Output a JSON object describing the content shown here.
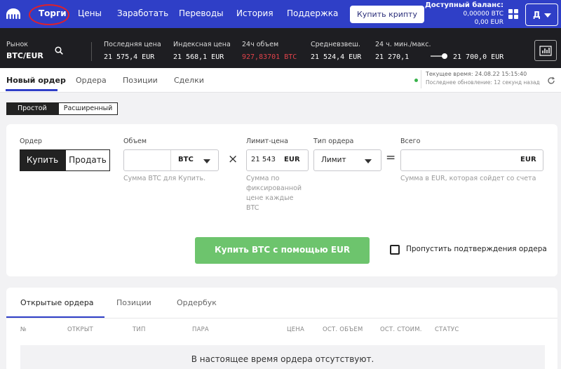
{
  "topnav": {
    "items": [
      "Торги",
      "Цены",
      "Заработать",
      "Переводы",
      "История",
      "Поддержка"
    ],
    "buy_crypto": "Купить крипту",
    "balance_title": "Доступный баланс:",
    "balance_btc": "0,00000 BTC",
    "balance_eur": "0,00 EUR",
    "user_initial": "Д",
    "colors": {
      "nav_bg": "#2f3fc7",
      "highlight_circle": "#e0202a"
    }
  },
  "market": {
    "market_label": "Рынок",
    "pair": "BTC/EUR",
    "stats": [
      {
        "label": "Последняя цена",
        "value": "21 575,4 EUR"
      },
      {
        "label": "Индексная цена",
        "value": "21 568,1 EUR"
      },
      {
        "label": "24ч объем",
        "value": "927,83701 BTC"
      },
      {
        "label": "Средневзвеш.",
        "value": "21 524,4 EUR"
      },
      {
        "label": "24 ч. мин./макс.",
        "min": "21 270,1",
        "max": "21 700,0 EUR"
      }
    ]
  },
  "tabs": {
    "items": [
      "Новый ордер",
      "Ордера",
      "Позиции",
      "Сделки"
    ],
    "current_time": "Текущее время: 24.08.22 15:15:40",
    "last_update": "Последнее обновление: 12 секунд назад"
  },
  "mode": {
    "simple": "Простой",
    "advanced": "Расширенный"
  },
  "order": {
    "order_label": "Ордер",
    "buy": "Купить",
    "sell": "Продать",
    "volume_label": "Объем",
    "volume_unit": "BTC",
    "volume_hint": "Сумма BTC для Купить.",
    "limit_label": "Лимит-цена",
    "limit_value": "21 543",
    "limit_unit": "EUR",
    "limit_hint": [
      "Сумма по",
      "фиксированной",
      "цене каждые",
      "BTC"
    ],
    "type_label": "Тип ордера",
    "type_value": "Лимит",
    "total_label": "Всего",
    "total_unit": "EUR",
    "total_hint": "Сумма в EUR, которая сойдет со счета",
    "submit": "Купить BTC с помощью EUR",
    "skip_confirm": "Пропустить подтверждения ордера",
    "colors": {
      "submit_bg": "#6dc46d"
    }
  },
  "bottom": {
    "tabs": [
      "Открытые ордера",
      "Позиции",
      "Ордербук"
    ],
    "columns": [
      "№",
      "ОТКРЫТ",
      "ТИП",
      "ПАРА",
      "ЦЕНА",
      "ОСТ. ОБЪЕМ",
      "ОСТ. СТОИМ.",
      "СТАТУС"
    ],
    "empty": "В настоящее время ордера отсутствуют."
  }
}
